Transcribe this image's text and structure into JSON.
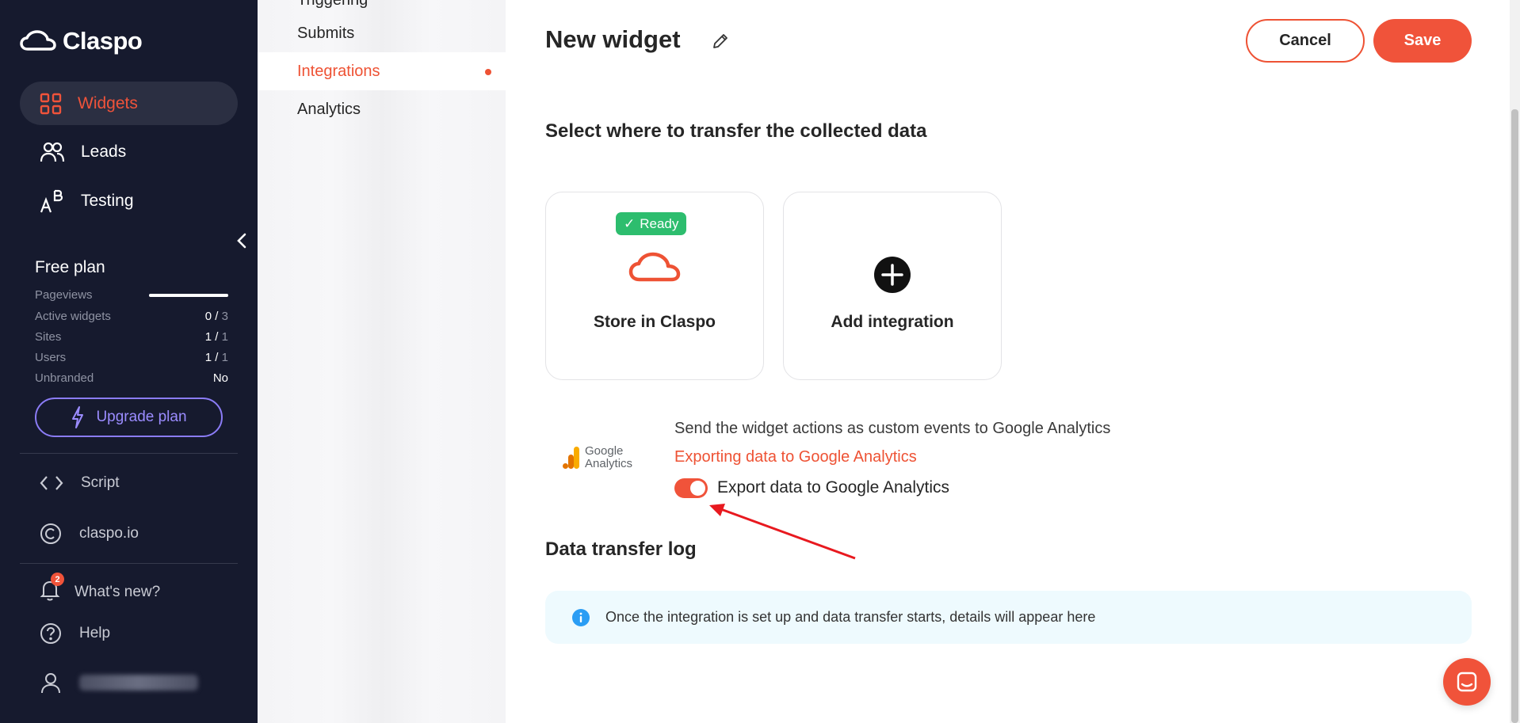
{
  "brand": {
    "name": "Claspo",
    "accent": "#f0533a"
  },
  "sidebar": {
    "nav": [
      {
        "label": "Widgets",
        "icon": "grid-icon",
        "active": true
      },
      {
        "label": "Leads",
        "icon": "users-icon"
      },
      {
        "label": "Testing",
        "icon": "ab-test-icon"
      }
    ],
    "plan": {
      "title": "Free plan",
      "pageviews_label": "Pageviews",
      "pageviews_fraction": 1.0,
      "active_widgets_label": "Active widgets",
      "active_widgets_used": "0",
      "active_widgets_limit": "3",
      "sites_label": "Sites",
      "sites_used": "1",
      "sites_limit": "1",
      "users_label": "Users",
      "users_used": "1",
      "users_limit": "1",
      "unbranded_label": "Unbranded",
      "unbranded_value": "No",
      "upgrade_label": "Upgrade plan"
    },
    "links": {
      "script": "Script",
      "site": "claspo.io"
    },
    "whats_new": {
      "label": "What's new?",
      "count": "2"
    },
    "help": "Help"
  },
  "subnav": {
    "cut_off_item": "Triggering",
    "items": [
      {
        "label": "Submits"
      },
      {
        "label": "Integrations",
        "active": true
      },
      {
        "label": "Analytics"
      }
    ]
  },
  "header": {
    "title": "New widget",
    "cancel_label": "Cancel",
    "save_label": "Save"
  },
  "integrations": {
    "section_title": "Select where to transfer the collected data",
    "cards": [
      {
        "label": "Store in Claspo",
        "badge": "Ready",
        "icon": "claspo-cloud-icon"
      },
      {
        "label": "Add integration",
        "icon": "plus-circle-icon"
      }
    ]
  },
  "google_analytics": {
    "logo_line1": "Google",
    "logo_line2": "Analytics",
    "description": "Send the widget actions as custom events to Google Analytics",
    "link": "Exporting data to Google Analytics",
    "toggle_label": "Export data to Google Analytics",
    "toggle_on": true
  },
  "log": {
    "title": "Data transfer log",
    "info": "Once the integration is set up and data transfer starts, details will appear here"
  }
}
